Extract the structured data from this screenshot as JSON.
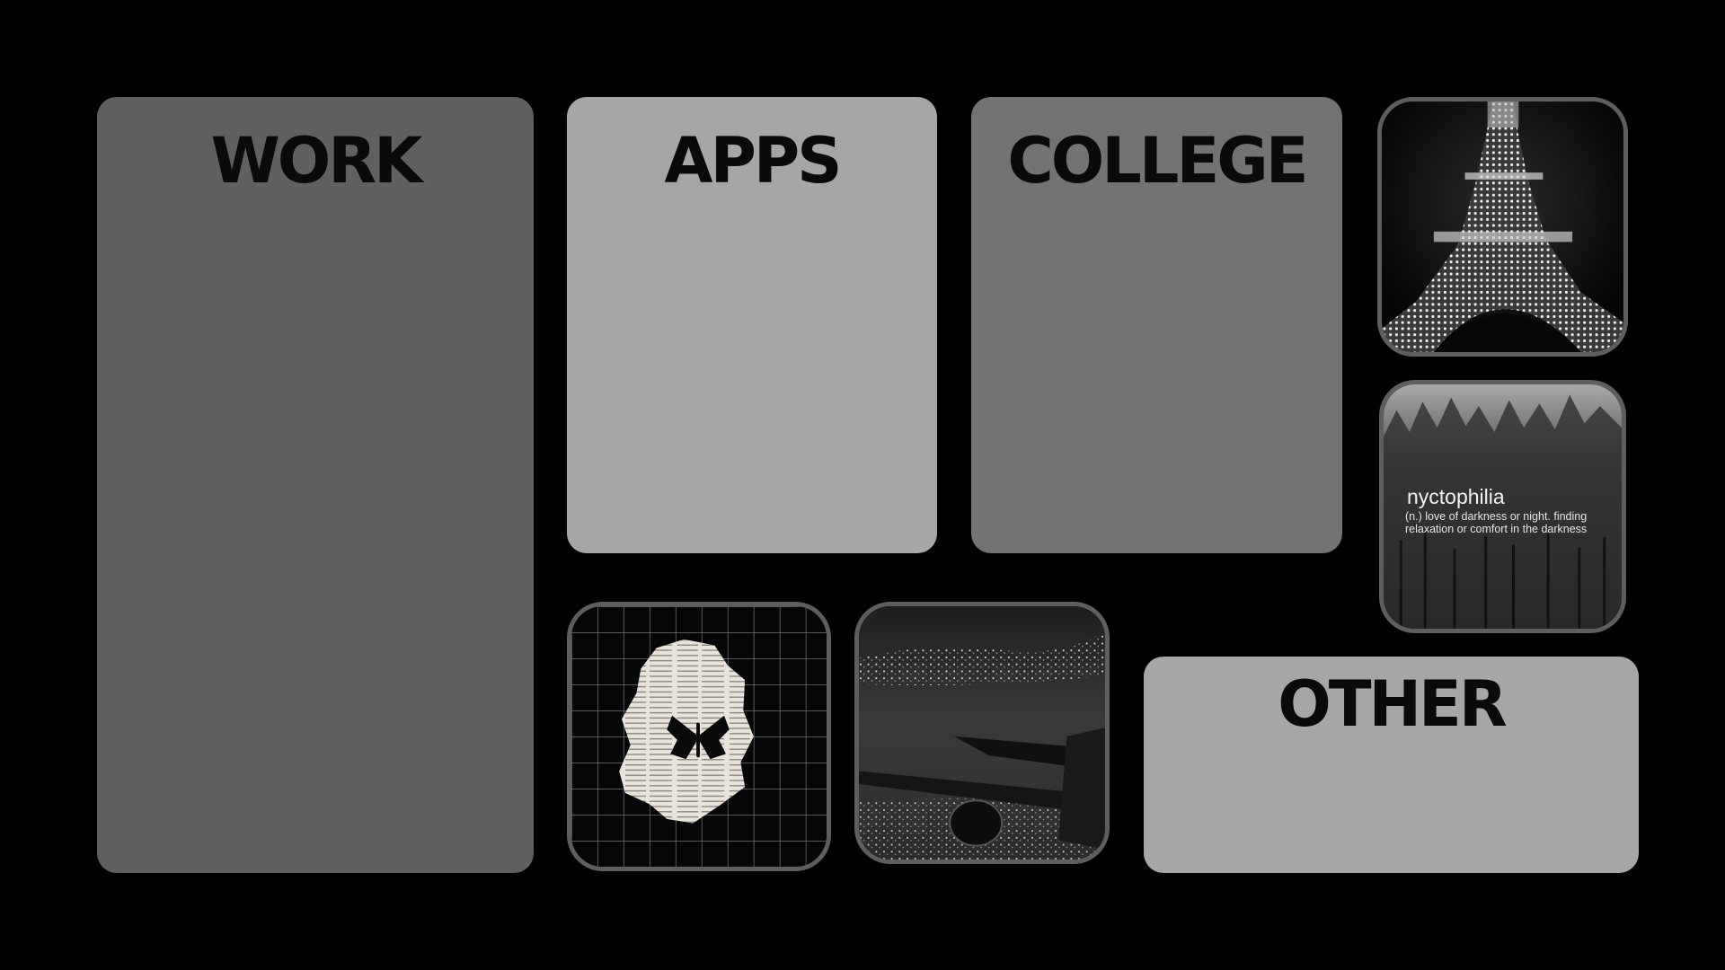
{
  "panels": {
    "work": {
      "title": "WORK",
      "color": "#606060"
    },
    "apps": {
      "title": "APPS",
      "color": "#a6a6a6"
    },
    "college": {
      "title": "COLLEGE",
      "color": "#737373"
    },
    "other": {
      "title": "OTHER",
      "color": "#a6a6a6"
    }
  },
  "photos": {
    "eiffel": {
      "icon": "eiffel-tower-photo"
    },
    "forest": {
      "icon": "foggy-forest-photo",
      "word": "nyctophilia",
      "definition": "(n.) love of darkness or night. finding relaxation or comfort in the darkness"
    },
    "butterfly": {
      "icon": "butterfly-collage-photo"
    },
    "airplane": {
      "icon": "airplane-night-photo"
    }
  },
  "colors": {
    "background": "#000000",
    "photo_border": "#5e5e5e",
    "title_text": "#0a0a0a"
  }
}
